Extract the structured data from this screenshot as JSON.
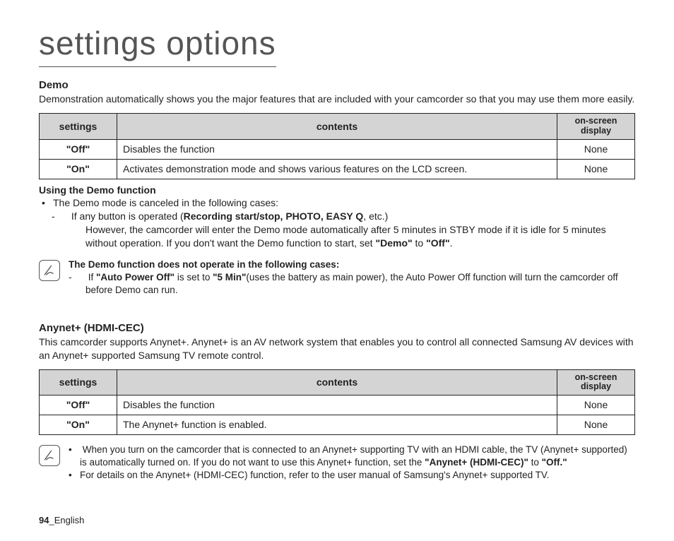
{
  "page_title": "settings options",
  "footer": {
    "page_number": "94",
    "lang": "_English"
  },
  "table_headers": {
    "settings": "settings",
    "contents": "contents",
    "osd": "on-screen display"
  },
  "demo": {
    "heading": "Demo",
    "body": "Demonstration automatically shows you the major features that are included with your camcorder so that you may use them more easily.",
    "rows": [
      {
        "setting": "\"Off\"",
        "contents": "Disables the function",
        "osd": "None"
      },
      {
        "setting": "\"On\"",
        "contents": "Activates demonstration mode and shows various features on the LCD screen.",
        "osd": "None"
      }
    ],
    "using_heading": "Using the Demo function",
    "bullet1": "The Demo mode is canceled in the following cases:",
    "dash1_pre": "If any button is operated (",
    "dash1_bold": "Recording start/stop, PHOTO, EASY Q",
    "dash1_post": ", etc.)",
    "dash1_cont_a": "However, the camcorder will enter the Demo mode automatically after 5 minutes in STBY mode if it is idle for 5 minutes without operation. If you don't want the Demo function to start, set ",
    "dash1_cont_b1": "\"Demo\"",
    "dash1_cont_mid": " to ",
    "dash1_cont_b2": "\"Off\"",
    "dash1_cont_end": ".",
    "note_title": "The Demo function does not operate in the following cases:",
    "note_dash_pre": "If ",
    "note_dash_b1": "\"Auto Power Off\"",
    "note_dash_mid1": " is set to ",
    "note_dash_b2": "\"5 Min\"",
    "note_dash_post": "(uses the battery as main power), the Auto Power Off function will turn the camcorder off before Demo can run."
  },
  "anynet": {
    "heading": "Anynet+ (HDMI-CEC)",
    "body": "This camcorder supports Anynet+. Anynet+ is an AV network system that enables you to control all connected Samsung AV devices with an Anynet+ supported Samsung TV remote control.",
    "rows": [
      {
        "setting": "\"Off\"",
        "contents": "Disables the function",
        "osd": "None"
      },
      {
        "setting": "\"On\"",
        "contents": "The Anynet+ function is enabled.",
        "osd": "None"
      }
    ],
    "note_b1_pre": "When you turn on the camcorder that is connected to an Anynet+ supporting TV with an HDMI cable, the TV (Anynet+ supported) is automatically turned on. If you do not want to use this Anynet+ function, set the ",
    "note_b1_bold": "\"Anynet+ (HDMI-CEC)\"",
    "note_b1_mid": " to ",
    "note_b1_bold2": "\"Off.\"",
    "note_b2": "For details on the Anynet+ (HDMI-CEC) function, refer to the user manual of Samsung's Anynet+ supported TV."
  }
}
